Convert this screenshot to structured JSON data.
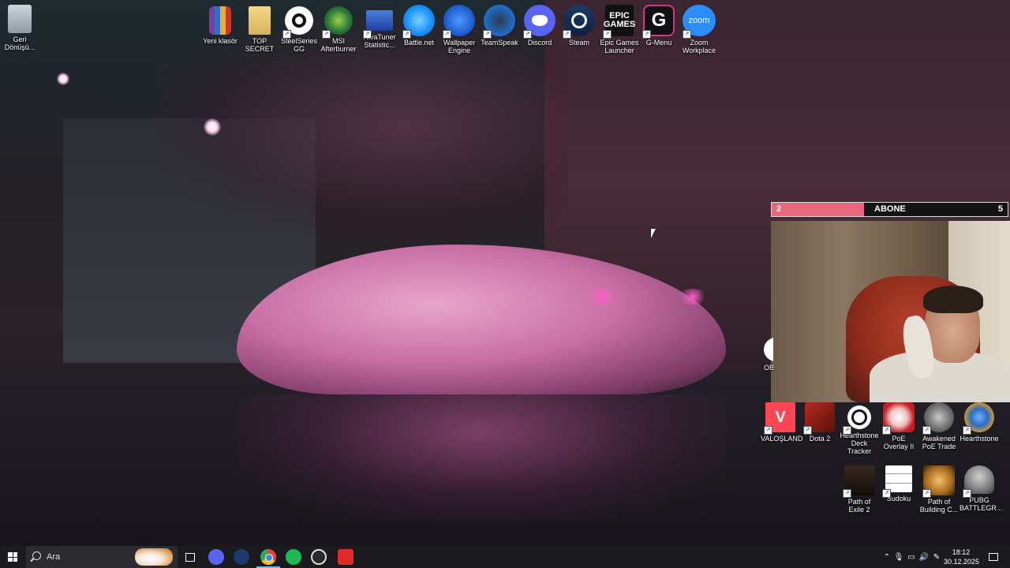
{
  "desktop": {
    "top_icons": [
      {
        "label": "Geri\nDönüşü...",
        "icon": "recycle-bin-icon"
      },
      {
        "label": "Yeni klasör",
        "icon": "winrar-archive-icon"
      },
      {
        "label": "TOP SECRET",
        "icon": "folder-icon"
      },
      {
        "label": "SteelSeries GG",
        "icon": "steelseries-icon"
      },
      {
        "label": "MSI Afterburner",
        "icon": "msi-afterburner-icon"
      },
      {
        "label": "RivaTuner Statistic...",
        "icon": "rivatuner-icon"
      },
      {
        "label": "Battle.net",
        "icon": "battlenet-icon"
      },
      {
        "label": "Wallpaper Engine",
        "icon": "wallpaper-engine-icon"
      },
      {
        "label": "TeamSpeak",
        "icon": "teamspeak-icon"
      },
      {
        "label": "Discord",
        "icon": "discord-icon"
      },
      {
        "label": "Steam",
        "icon": "steam-icon"
      },
      {
        "label": "Epic Games Launcher",
        "icon": "epic-games-icon",
        "text": "EPIC\nGAMES"
      },
      {
        "label": "G-Menu",
        "icon": "g-menu-icon",
        "text": "G"
      },
      {
        "label": "Zoom Workplace",
        "icon": "zoom-icon",
        "text": "zoom"
      }
    ],
    "game_icons_row1": [
      {
        "label": "VALOŞLAND",
        "icon": "valorant-icon"
      },
      {
        "label": "Dota 2",
        "icon": "dota2-icon"
      },
      {
        "label": "Hearthstone Deck Tracker",
        "icon": "hearthstone-deck-tracker-icon"
      },
      {
        "label": "PoE Overlay II",
        "icon": "poe-overlay-icon"
      },
      {
        "label": "Awakened PoE Trade",
        "icon": "awakened-poe-trade-icon"
      },
      {
        "label": "Hearthstone",
        "icon": "hearthstone-icon"
      }
    ],
    "game_icons_row2": [
      {
        "label": "Path of Exile 2",
        "icon": "path-of-exile-2-icon"
      },
      {
        "label": "Sudoku",
        "icon": "sudoku-icon"
      },
      {
        "label": "Path of Building C...",
        "icon": "path-of-building-icon"
      },
      {
        "label": "PUBG BATTLEGR...",
        "icon": "pubg-icon"
      }
    ],
    "partial_icon_label": "OB"
  },
  "overlay": {
    "subscriber_goal": {
      "title": "ABONE",
      "current": "2",
      "goal": "5",
      "progress_fraction": 0.39,
      "fill_color": "#e7687c"
    }
  },
  "taskbar": {
    "search_placeholder": "Ara",
    "apps": [
      {
        "name": "task-view-icon"
      },
      {
        "name": "discord-taskbar-icon"
      },
      {
        "name": "steam-taskbar-icon"
      },
      {
        "name": "chrome-taskbar-icon",
        "active": true
      },
      {
        "name": "spotify-taskbar-icon"
      },
      {
        "name": "obs-taskbar-icon"
      },
      {
        "name": "app-red-taskbar-icon"
      }
    ],
    "clock": {
      "time": "18:12",
      "date": "30.12.2025"
    }
  }
}
